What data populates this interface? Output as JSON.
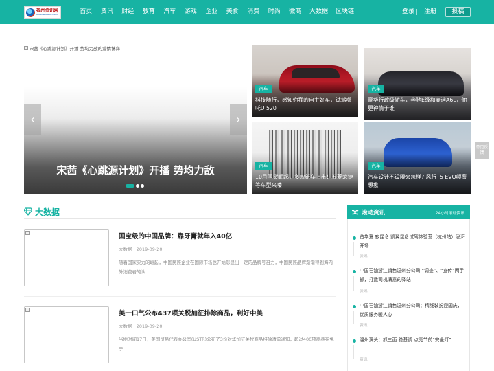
{
  "header": {
    "logo_text": "福州资讯网",
    "logo_subtext": "www.wuazxl.com",
    "nav": [
      "首页",
      "资讯",
      "财经",
      "教育",
      "汽车",
      "游戏",
      "企业",
      "美食",
      "消费",
      "时尚",
      "微商",
      "大数据",
      "区块链"
    ],
    "login_label": "登录",
    "register_label": "注册",
    "submit_label": "投稿"
  },
  "slider": {
    "image_alt": "宋茜《心跳源计划》开播 势均力敌的爱情博弈",
    "title": "宋茜《心跳源计划》开播 势均力敌",
    "prev_icon": "‹",
    "next_icon": "›",
    "active_index": 0,
    "slide_count": 3
  },
  "cards": [
    {
      "tag": "汽车",
      "title": "科技随行，感知你我的自主好车，试驾哪吒U 520"
    },
    {
      "tag": "汽车",
      "title": "豪华行政级轿车，奔驰E级和奥迪A6L，你更钟情于谁"
    },
    {
      "tag": "汽车",
      "title": "10月国货崛起，多款新车上市！五菱荣捷等车型来喽"
    },
    {
      "tag": "汽车",
      "title": "汽车设计不设限会怎样? 风行T5 EVO颠覆想象"
    }
  ],
  "feedback_label": "意见反馈",
  "bigdata": {
    "section_title": "大数据",
    "articles": [
      {
        "title": "国宝级的中国品牌：靠牙膏就年入40亿",
        "meta": "大数据 · 2019-09-20",
        "summary": "随着国家实力的崛起，中国民族企业在国际市场也开始彰显出一定的品牌号召力，中国民族品牌渐渐得到海内外消费者的认..."
      },
      {
        "title": "美一口气公布437项关税加征排除商品，利好中美",
        "meta": "大数据 · 2019-09-20",
        "summary": "当地时间17日，美国贸易代表办公室(USTR)公布了3份对华加征关税商品排除清单通知，超过400项商品在免于..."
      }
    ]
  },
  "rolling": {
    "title": "滚动资讯",
    "subtitle": "24小时滚动资讯",
    "items": [
      {
        "text": "览华夏 寂昆仑 凯翼昆仑试驾体验营（杭州站）澎湃开场",
        "meta": "资讯"
      },
      {
        "text": "中国石油浙江销售温州分公司:“调查”、“宣传”两手抓，打造司机满意的驿站",
        "meta": "资讯"
      },
      {
        "text": "中国石油浙江销售温州分公司：精细装扮迎国庆，优质服务暖人心",
        "meta": "资讯"
      },
      {
        "text": "温州洞头：抓三面 稳基调 点亮节前“安全灯”",
        "meta": "资讯"
      }
    ]
  },
  "colors": {
    "accent": "#17b3a3"
  }
}
